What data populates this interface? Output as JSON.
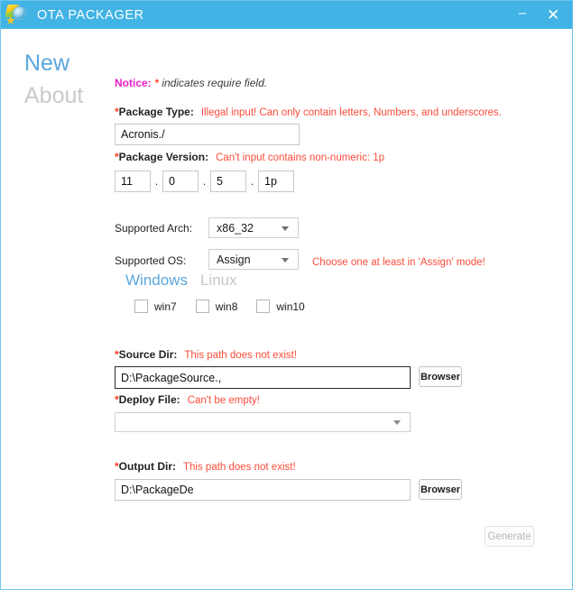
{
  "window": {
    "title": "OTA PACKAGER",
    "icon": "app-globe-icon",
    "minimize_label": "–",
    "close_label": "✕",
    "accent_color": "#41b3e5",
    "border_color": "#6fc5ef"
  },
  "nav": {
    "items": [
      {
        "label": "New",
        "active": true
      },
      {
        "label": "About",
        "active": false
      }
    ]
  },
  "notice": {
    "label": "Notice:",
    "star": "*",
    "text": "indicates require field."
  },
  "fields": {
    "package_type": {
      "star": "*",
      "label": "Package Type:",
      "error": "Illegal input! Can only contain letters, Numbers, and underscores.",
      "value": "Acronis./"
    },
    "package_version": {
      "star": "*",
      "label": "Package Version:",
      "error": "Can't input contains non-numeric: 1p",
      "separator": ".",
      "parts": [
        "11",
        "0",
        "5",
        "1p"
      ]
    },
    "supported_arch": {
      "label": "Supported Arch:",
      "value": "x86_32"
    },
    "supported_os": {
      "label": "Supported OS:",
      "value": "Assign",
      "error": "Choose one at least in 'Assign' mode!"
    },
    "os_tabs": [
      {
        "label": "Windows",
        "active": true
      },
      {
        "label": "Linux",
        "active": false
      }
    ],
    "os_checkboxes": [
      {
        "label": "win7",
        "checked": false
      },
      {
        "label": "win8",
        "checked": false
      },
      {
        "label": "win10",
        "checked": false
      }
    ],
    "source_dir": {
      "star": "*",
      "label": "Source Dir:",
      "error": "This path does not exist!",
      "value": "D:\\PackageSource.,",
      "browse_label": "Browser",
      "focused": true
    },
    "deploy_file": {
      "star": "*",
      "label": "Deploy File:",
      "error": "Can't be empty!",
      "value": ""
    },
    "output_dir": {
      "star": "*",
      "label": "Output Dir:",
      "error": "This path does not exist!",
      "value": "D:\\PackageDe",
      "browse_label": "Browser"
    }
  },
  "actions": {
    "generate_label": "Generate"
  },
  "colors": {
    "error": "#fb4c3b",
    "notice": "#e91ec8",
    "required_star": "#ff3b1f",
    "active_nav": "#5ba7dd",
    "inactive_nav": "#c9c9c9"
  }
}
